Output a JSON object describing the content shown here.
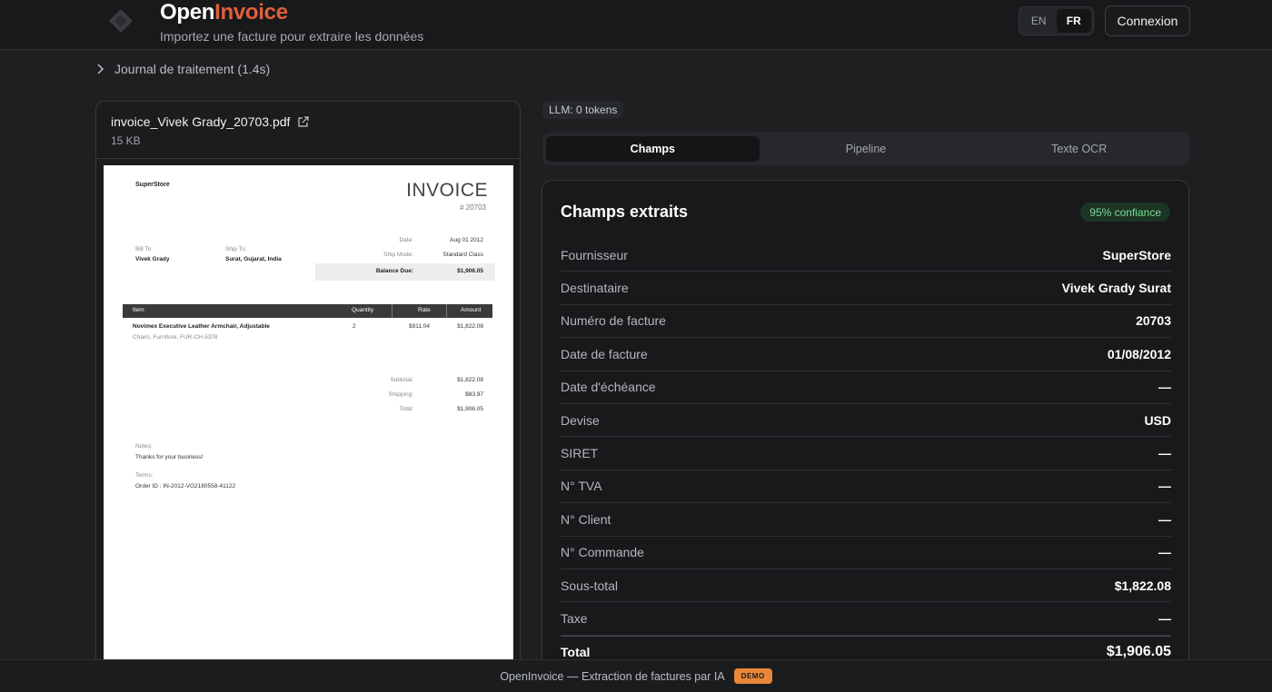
{
  "header": {
    "brand_part1": "Open",
    "brand_part2": "Invoice",
    "subtitle": "Importez une facture pour extraire les données",
    "lang_en": "EN",
    "lang_fr": "FR",
    "connexion_label": "Connexion"
  },
  "journal": {
    "label": "Journal de traitement (1.4s)"
  },
  "file": {
    "name": "invoice_Vivek Grady_20703.pdf",
    "size": "15 KB"
  },
  "invoice_preview": {
    "store": "SuperStore",
    "title": "INVOICE",
    "number": "# 20703",
    "bill_to_label": "Bill To:",
    "bill_to": "Vivek Grady",
    "ship_to_label": "Ship To:",
    "ship_to": "Surat, Gujarat, India",
    "date_label": "Date:",
    "date": "Aug 01 2012",
    "ship_mode_label": "Ship Mode:",
    "ship_mode": "Standard Class",
    "balance_label": "Balance Due:",
    "balance": "$1,906.05",
    "col_item": "Item",
    "col_qty": "Quantity",
    "col_rate": "Rate",
    "col_amount": "Amount",
    "item_name": "Novimex Executive Leather Armchair, Adjustable",
    "item_desc": "Chairs, Furniture, FUR-CH-5378",
    "item_qty": "2",
    "item_rate": "$911.04",
    "item_amount": "$1,822.08",
    "subtotal_label": "Subtotal:",
    "subtotal": "$1,822.08",
    "shipping_label": "Shipping:",
    "shipping": "$83.97",
    "total_label": "Total:",
    "total": "$1,906.05",
    "notes_label": "Notes:",
    "notes": "Thanks for your business!",
    "terms_label": "Terms:",
    "terms": "Order ID : IN-2012-VG2180558-41122"
  },
  "llm": {
    "label": "LLM: 0 tokens"
  },
  "tabs": [
    "Champs",
    "Pipeline",
    "Texte OCR"
  ],
  "fields": {
    "title": "Champs extraits",
    "confidence": "95% confiance",
    "rows": [
      {
        "label": "Fournisseur",
        "value": "SuperStore"
      },
      {
        "label": "Destinataire",
        "value": "Vivek Grady Surat"
      },
      {
        "label": "Numéro de facture",
        "value": "20703"
      },
      {
        "label": "Date de facture",
        "value": "01/08/2012"
      },
      {
        "label": "Date d'échéance",
        "value": "—"
      },
      {
        "label": "Devise",
        "value": "USD"
      },
      {
        "label": "SIRET",
        "value": "—"
      },
      {
        "label": "N° TVA",
        "value": "—"
      },
      {
        "label": "N° Client",
        "value": "—"
      },
      {
        "label": "N° Commande",
        "value": "—"
      },
      {
        "label": "Sous-total",
        "value": "$1,822.08"
      },
      {
        "label": "Taxe",
        "value": "—"
      },
      {
        "label": "Total",
        "value": "$1,906.05"
      }
    ]
  },
  "footer": {
    "text": "OpenInvoice — Extraction de factures par IA",
    "badge": "DEMO"
  },
  "colors": {
    "accent": "#e0603a",
    "confidence_green": "#7bd896",
    "demo_orange": "#e8873a"
  },
  "icons": [
    "logo-icon",
    "chevron-right-icon",
    "external-link-icon"
  ]
}
